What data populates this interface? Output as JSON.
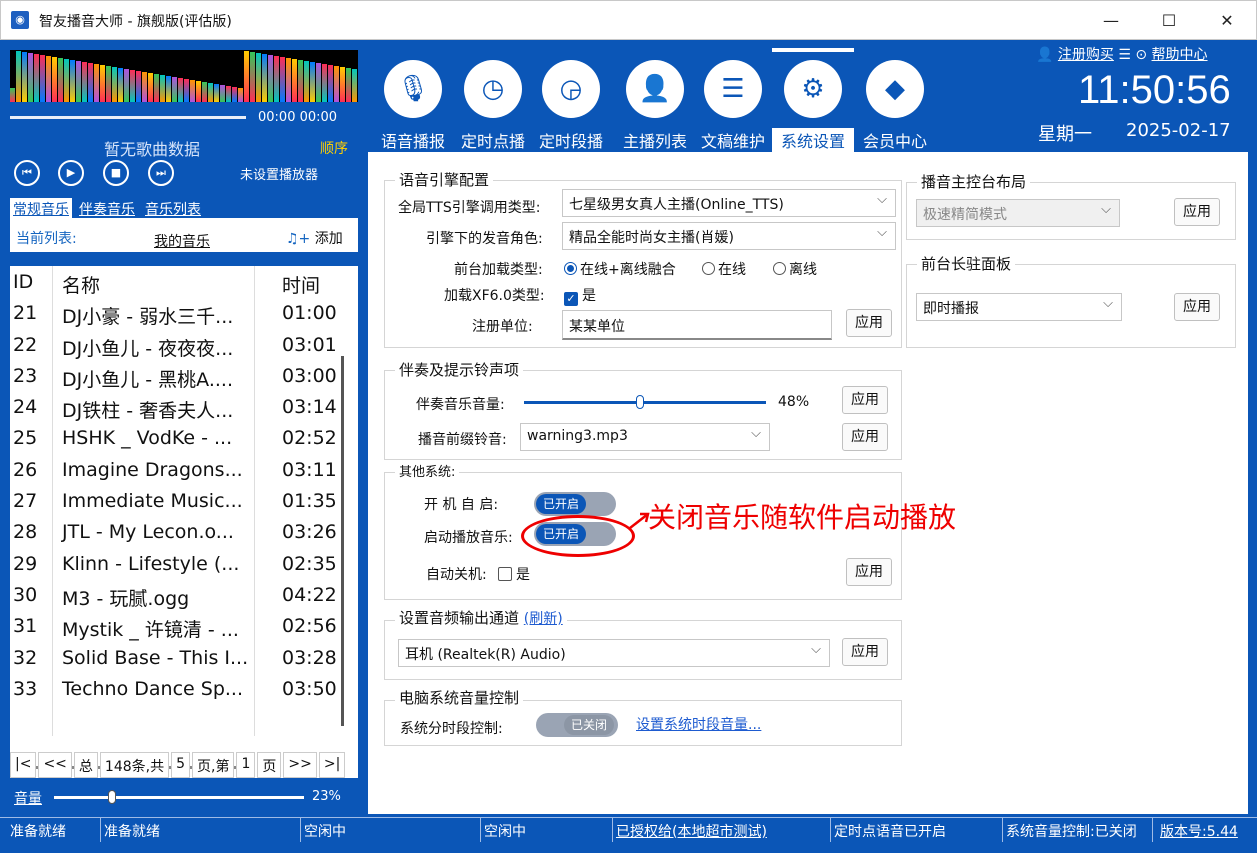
{
  "window": {
    "title": "智友播音大师 - 旗舰版(评估版)",
    "minimize": "—",
    "maximize": "☐",
    "close": "✕"
  },
  "player": {
    "time": "00:00  00:00",
    "no_song": "暂无歌曲数据",
    "order_mode": "顺序",
    "no_player": "未设置播放器",
    "controls": [
      "⏮",
      "▶",
      "■",
      "⏭"
    ]
  },
  "music_tabs": [
    "常规音乐",
    "伴奏音乐",
    "音乐列表"
  ],
  "list_header": {
    "label": "当前列表:",
    "name": "我的音乐",
    "add": "添加"
  },
  "song_table": {
    "columns": [
      "ID",
      "名称",
      "时间"
    ],
    "rows": [
      [
        "21",
        "DJ小豪 - 弱水三千...",
        "01:00"
      ],
      [
        "22",
        "DJ小鱼儿 - 夜夜夜...",
        "03:01"
      ],
      [
        "23",
        "DJ小鱼儿 - 黑桃A....",
        "03:00"
      ],
      [
        "24",
        "DJ铁柱 - 奢香夫人...",
        "03:14"
      ],
      [
        "25",
        "HSHK _ VodKe - ...",
        "02:52"
      ],
      [
        "26",
        "Imagine Dragons...",
        "03:11"
      ],
      [
        "27",
        "Immediate Music...",
        "01:35"
      ],
      [
        "28",
        "JTL - My Lecon.o...",
        "03:26"
      ],
      [
        "29",
        "Klinn - Lifestyle (...",
        "02:35"
      ],
      [
        "30",
        "M3 - 玩腻.ogg",
        "04:22"
      ],
      [
        "31",
        "Mystik _ 许镜清 - ...",
        "02:56"
      ],
      [
        "32",
        "Solid Base - This I...",
        "03:28"
      ],
      [
        "33",
        "Techno Dance Sp...",
        "03:50"
      ]
    ]
  },
  "pager": [
    "|<",
    "<<",
    "总",
    "148条,共",
    "5",
    "页,第",
    "1",
    "页",
    ">>",
    ">|"
  ],
  "volume": {
    "label": "音量",
    "percent": "23%",
    "value": 0.23
  },
  "nav": [
    {
      "label": "语音播报",
      "icon": "microphone-icon"
    },
    {
      "label": "定时点播",
      "icon": "clock-icon"
    },
    {
      "label": "定时段播",
      "icon": "clock-range-icon"
    },
    {
      "label": "主播列表",
      "icon": "person-icon"
    },
    {
      "label": "文稿维护",
      "icon": "document-icon"
    },
    {
      "label": "系统设置",
      "icon": "gear-icon"
    },
    {
      "label": "会员中心",
      "icon": "diamond-icon"
    }
  ],
  "topright": {
    "register": "注册购买",
    "help": "帮助中心",
    "clock": "11:50:56",
    "weekday": "星期一",
    "date": "2025-02-17"
  },
  "tts": {
    "title": "语音引擎配置",
    "engine_label": "全局TTS引擎调用类型:",
    "engine_value": "七星级男女真人主播(Online_TTS)",
    "role_label": "引擎下的发音角色:",
    "role_value": "精品全能时尚女主播(肖媛)",
    "load_label": "前台加载类型:",
    "load_options": [
      "在线+离线融合",
      "在线",
      "离线"
    ],
    "xf_label": "加载XF6.0类型:",
    "xf_value": "是",
    "reg_label": "注册单位:",
    "reg_value": "某某单位",
    "apply": "应用"
  },
  "accomp": {
    "title": "伴奏及提示铃声项",
    "volume_label": "伴奏音乐音量:",
    "volume_percent": "48%",
    "volume_value": 0.48,
    "bell_label": "播音前缀铃音:",
    "bell_value": "warning3.mp3",
    "apply": "应用"
  },
  "other": {
    "title": "其他系统:",
    "boot_label": "开 机 自 启:",
    "boot_state": "已开启",
    "music_label": "启动播放音乐:",
    "music_state": "已开启",
    "shutdown_label": "自动关机:",
    "shutdown_value": "是",
    "apply": "应用"
  },
  "annotation": "关闭音乐随软件启动播放",
  "audio_out": {
    "title": "设置音频输出通道",
    "refresh": "(刷新)",
    "value": "耳机 (Realtek(R) Audio)",
    "apply": "应用"
  },
  "sysvol": {
    "title": "电脑系统音量控制",
    "label": "系统分时段控制:",
    "state": "已关闭",
    "link": "设置系统时段音量..."
  },
  "layout_panel": {
    "title": "播音主控台布局",
    "value": "极速精简模式",
    "apply": "应用"
  },
  "front_panel": {
    "title": "前台长驻面板",
    "value": "即时播报",
    "apply": "应用"
  },
  "statusbar": [
    "准备就绪",
    "准备就绪",
    "空闲中",
    "空闲中",
    "已授权给(本地超市测试)",
    "定时点语音已开启",
    "系统音量控制:已关闭",
    "版本号:5.44"
  ]
}
